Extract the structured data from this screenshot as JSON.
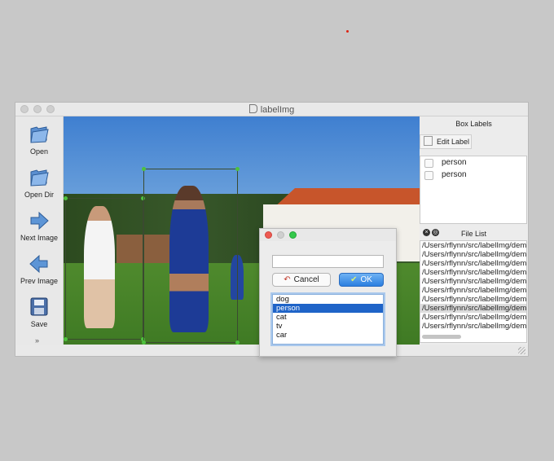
{
  "window": {
    "title": "labelImg"
  },
  "toolbar": {
    "items": [
      {
        "label": "Open",
        "icon": "folder-open-icon"
      },
      {
        "label": "Open Dir",
        "icon": "folder-open-icon"
      },
      {
        "label": "Next Image",
        "icon": "arrow-right-icon"
      },
      {
        "label": "Prev Image",
        "icon": "arrow-left-icon"
      },
      {
        "label": "Save",
        "icon": "floppy-disk-icon"
      }
    ],
    "more": "»"
  },
  "box_labels": {
    "title": "Box Labels",
    "edit_label": "Edit Label",
    "items": [
      "person",
      "person"
    ]
  },
  "file_list": {
    "title": "File List",
    "files": [
      "/Users/rflynn/src/labelImg/dem",
      "/Users/rflynn/src/labelImg/dem",
      "/Users/rflynn/src/labelImg/dem",
      "/Users/rflynn/src/labelImg/dem",
      "/Users/rflynn/src/labelImg/dem",
      "/Users/rflynn/src/labelImg/dem",
      "/Users/rflynn/src/labelImg/dem",
      "/Users/rflynn/src/labelImg/dem",
      "/Users/rflynn/src/labelImg/dem",
      "/Users/rflynn/src/labelImg/dem"
    ],
    "selected_index": 7
  },
  "dialog": {
    "input_value": "",
    "cancel_label": "Cancel",
    "ok_label": "OK",
    "options": [
      "dog",
      "person",
      "cat",
      "tv",
      "car"
    ],
    "selected_index": 1
  },
  "colors": {
    "box_handle": "#4ec23e",
    "ok_button": "#2b7fe0",
    "selection": "#1f64c8",
    "close_light": "#ee5a52",
    "zoom_light": "#34c84a"
  }
}
